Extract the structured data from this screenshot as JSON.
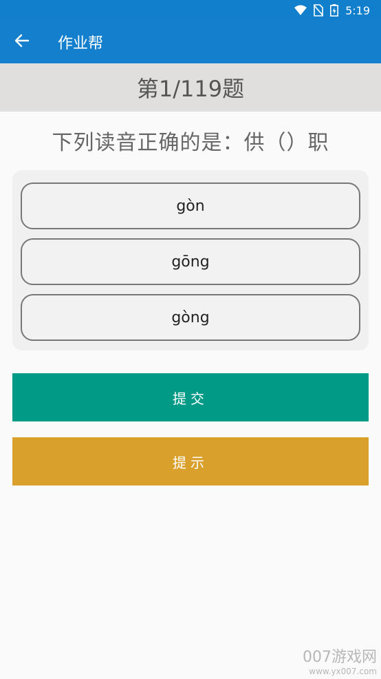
{
  "statusbar": {
    "time": "5:19"
  },
  "appbar": {
    "title": "作业帮"
  },
  "quiz": {
    "counter": "第1/119题",
    "question": "下列读音正确的是：供（）职",
    "options": [
      {
        "label": "gòn"
      },
      {
        "label": "gōng"
      },
      {
        "label": "gòng"
      }
    ]
  },
  "actions": {
    "submit": "提交",
    "hint": "提示"
  },
  "watermark": {
    "brand": "007游戏网",
    "url": "www.yx007.com"
  },
  "colors": {
    "appbar": "#137fcd",
    "submit": "#009a87",
    "hint": "#d9a02c"
  }
}
